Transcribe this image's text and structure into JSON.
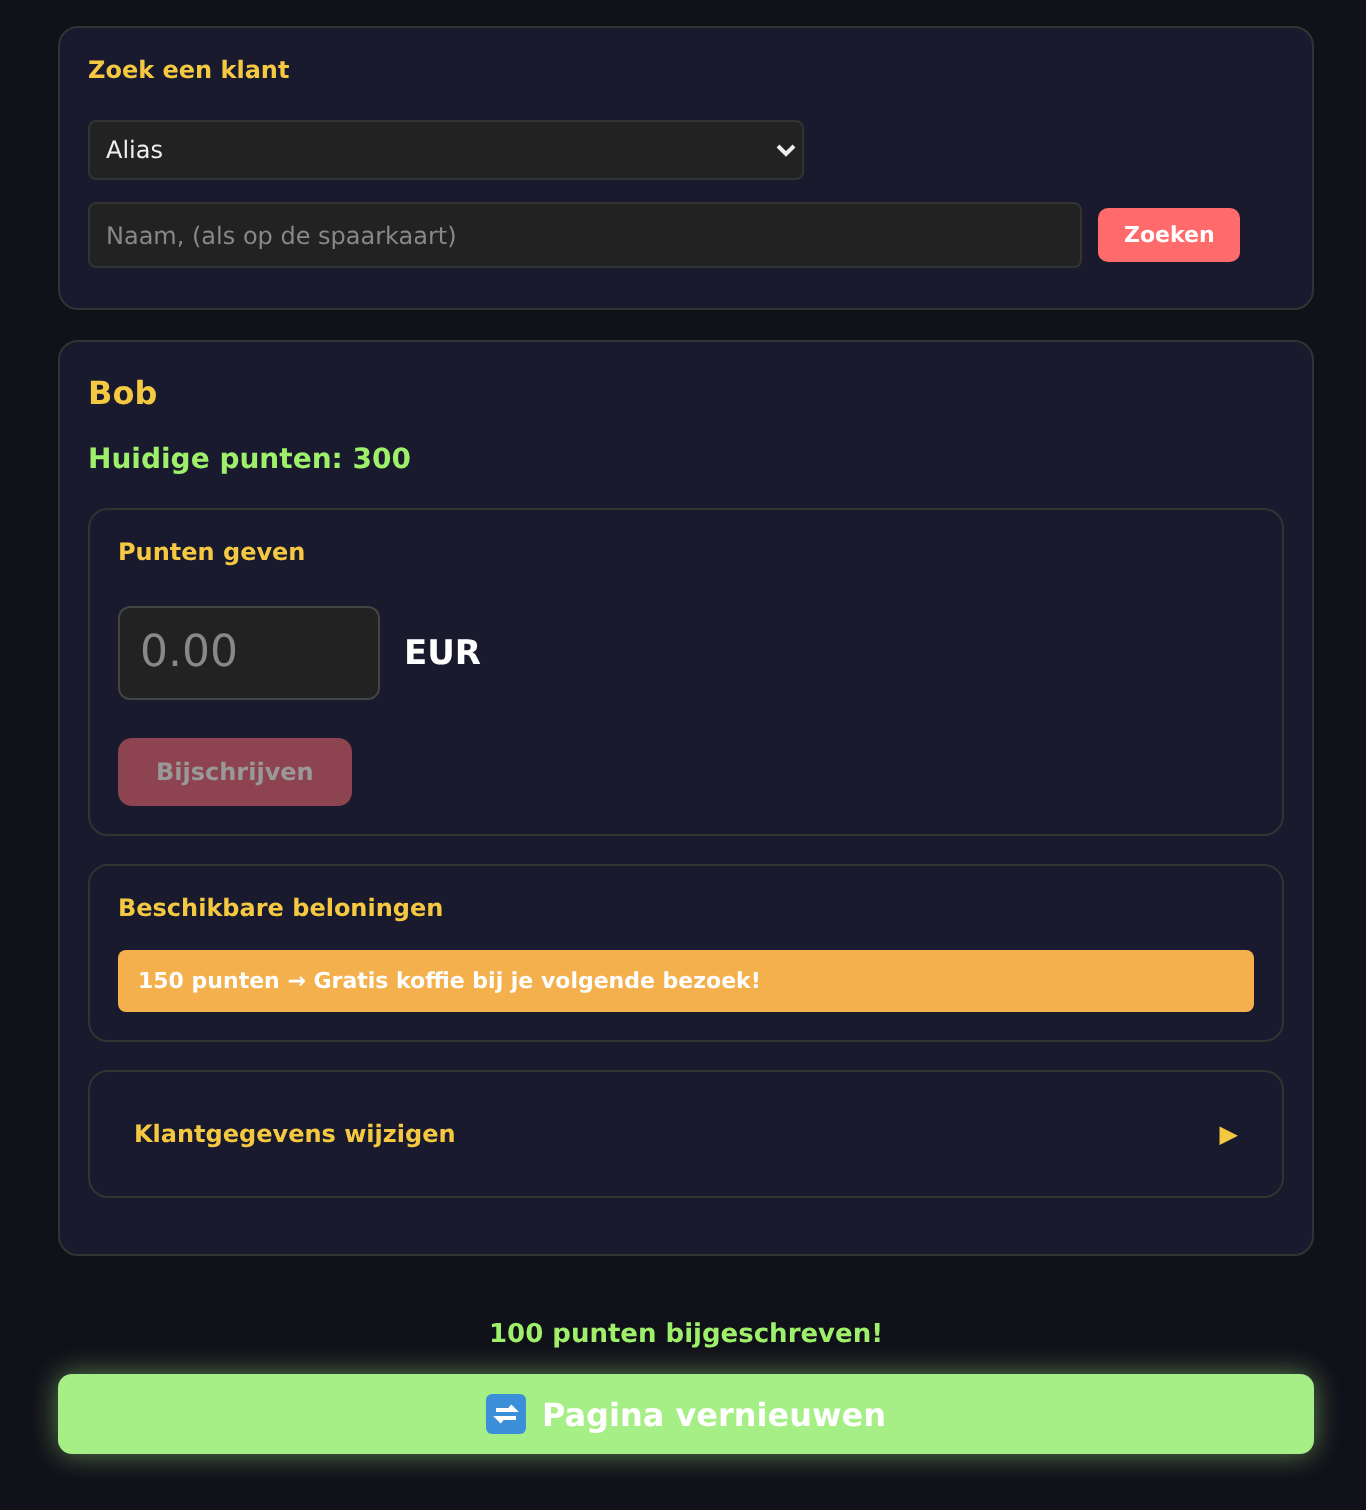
{
  "search": {
    "title": "Zoek een klant",
    "select": {
      "value": "Alias"
    },
    "name_field": {
      "placeholder": "Naam, (als op de spaarkaart)"
    },
    "button": "Zoeken"
  },
  "customer": {
    "name": "Bob",
    "points": "Huidige punten: 300",
    "give_points": {
      "title": "Punten geven",
      "amount": {
        "placeholder": "0.00"
      },
      "currency": "EUR",
      "button": {
        "label": "Bijschrijven",
        "disabled": true
      }
    },
    "rewards": {
      "title": "Beschikbare beloningen",
      "items": [
        "150 punten → Gratis koffie bij je volgende bezoek!"
      ]
    },
    "edit_details": {
      "title": "Klantgegevens wijzigen",
      "toggle": "▶",
      "expanded": false
    }
  },
  "message": "100 punten bijgeschreven!",
  "refresh_button": "Pagina vernieuwen"
}
